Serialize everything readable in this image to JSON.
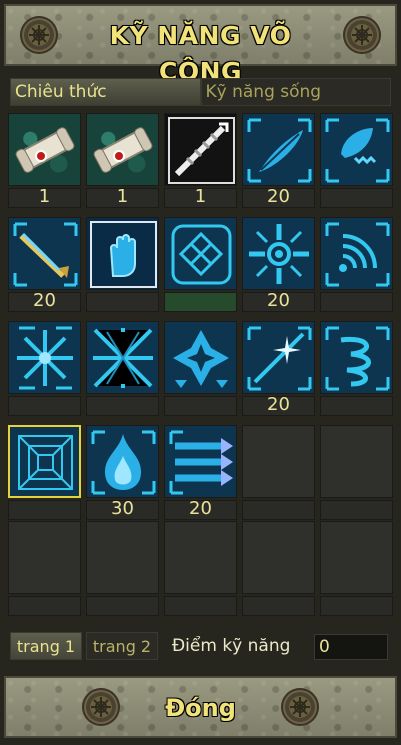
{
  "window": {
    "title": "KỸ NĂNG VÕ CÔNG",
    "close_label": "Đóng"
  },
  "tabs": [
    {
      "label": "Chiêu thức",
      "active": true
    },
    {
      "label": "Kỹ năng sống",
      "active": false
    }
  ],
  "skills": [
    {
      "icon": "scroll-red-seal-icon",
      "level": "1"
    },
    {
      "icon": "scroll-red-seal-icon",
      "level": "1"
    },
    {
      "icon": "spiked-blade-icon",
      "level": "1"
    },
    {
      "icon": "feather-wing-icon",
      "level": "20"
    },
    {
      "icon": "swirling-leaf-icon",
      "level": ""
    },
    {
      "icon": "sword-slash-icon",
      "level": "20"
    },
    {
      "icon": "open-palm-icon",
      "level": ""
    },
    {
      "icon": "knot-pattern-icon",
      "level": ""
    },
    {
      "icon": "radiant-cross-icon",
      "level": "20"
    },
    {
      "icon": "sound-waves-icon",
      "level": ""
    },
    {
      "icon": "snowflake-burst-icon",
      "level": ""
    },
    {
      "icon": "converging-rays-icon",
      "level": ""
    },
    {
      "icon": "four-petal-star-icon",
      "level": ""
    },
    {
      "icon": "sparkle-burst-icon",
      "level": "20"
    },
    {
      "icon": "coiled-swirl-icon",
      "level": ""
    },
    {
      "icon": "vortex-tunnel-icon",
      "level": "",
      "selected": true
    },
    {
      "icon": "flame-burst-icon",
      "level": "30"
    },
    {
      "icon": "triple-arrows-icon",
      "level": "20"
    }
  ],
  "pages": [
    {
      "label": "trang 1",
      "active": true
    },
    {
      "label": "trang 2",
      "active": false
    }
  ],
  "skill_points": {
    "label": "Điểm kỹ năng",
    "value": "0"
  },
  "colors": {
    "accent_gold": "#f1e27a",
    "icon_cyan": "#33c8f0",
    "selection_yellow": "#e6d23a"
  }
}
